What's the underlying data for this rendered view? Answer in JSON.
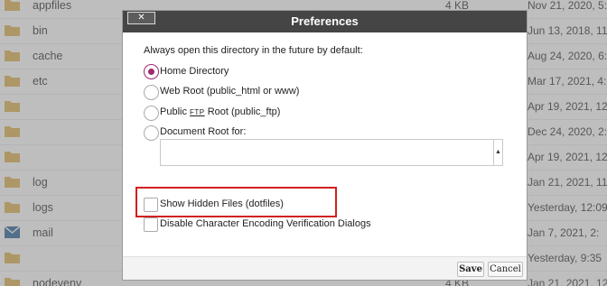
{
  "files": [
    {
      "name": "appfiles",
      "size": "4 KB",
      "date": "Nov 21, 2020, 5:",
      "icon": "folder-icon"
    },
    {
      "name": "bin",
      "size": "",
      "date": "Jun 13, 2018, 11:",
      "icon": "folder-icon"
    },
    {
      "name": "cache",
      "size": "",
      "date": "Aug 24, 2020, 6:",
      "icon": "folder-icon"
    },
    {
      "name": "etc",
      "size": "",
      "date": "Mar 17, 2021, 4:",
      "icon": "folder-icon"
    },
    {
      "name": "",
      "size": "",
      "date": "Apr 19, 2021, 12:",
      "icon": "folder-icon"
    },
    {
      "name": "",
      "size": "",
      "date": "Dec 24, 2020, 2:",
      "icon": "folder-icon"
    },
    {
      "name": "",
      "size": "",
      "date": "Apr 19, 2021, 12:",
      "icon": "folder-icon"
    },
    {
      "name": "log",
      "size": "",
      "date": "Jan 21, 2021, 11:",
      "icon": "folder-icon"
    },
    {
      "name": "logs",
      "size": "",
      "date": "Yesterday, 12:09",
      "icon": "folder-icon"
    },
    {
      "name": "mail",
      "size": "",
      "date": "Jan 7, 2021, 2:",
      "icon": "mail-icon"
    },
    {
      "name": "",
      "size": "",
      "date": "Yesterday, 9:35",
      "icon": "folder-icon"
    },
    {
      "name": "nodevenv",
      "size": "4 KB",
      "date": "Jan 21, 2021, 12:",
      "icon": "folder-icon"
    }
  ],
  "dialog": {
    "title": "Preferences",
    "close_label": "✕",
    "intro": "Always open this directory in the future by default:",
    "radios": [
      {
        "label": "Home Directory",
        "checked": true
      },
      {
        "label": "Web Root (public_html or www)",
        "checked": false
      },
      {
        "label_pre": "Public ",
        "label_ftp": "FTP",
        "label_post": " Root (public_ftp)",
        "checked": false
      },
      {
        "label": "Document Root for:",
        "checked": false
      }
    ],
    "docroot_value": "",
    "checkboxes": [
      {
        "label": "Show Hidden Files (dotfiles)",
        "checked": false
      },
      {
        "label": "Disable Character Encoding Verification Dialogs",
        "checked": false
      }
    ],
    "save_label": "Save",
    "cancel_label": "Cancel"
  },
  "colors": {
    "accent": "#a0276e",
    "highlight": "#d21f1f",
    "titlebar": "#454545",
    "folder": "#e0b860"
  }
}
